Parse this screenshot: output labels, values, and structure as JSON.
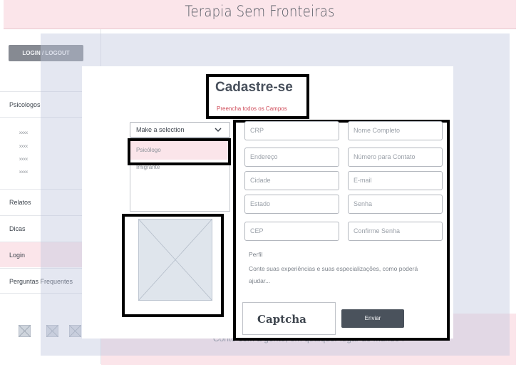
{
  "header": {
    "title": "Terapia Sem Fronteiras"
  },
  "login_button": {
    "label": "LOGIN / LOGOUT"
  },
  "sidebar": {
    "items": [
      {
        "label": "Psicologos"
      },
      {
        "label": "Relatos"
      },
      {
        "label": "Dicas"
      },
      {
        "label": "Login"
      },
      {
        "label": "Perguntas Frequentes"
      }
    ],
    "subitems": [
      "xxxx",
      "xxxx",
      "xxxx",
      "xxxx"
    ]
  },
  "footer": {
    "text": "Conte com a gente, em qualquer lugar do mundo !"
  },
  "social_icons": [
    "image-placeholder-icon",
    "image-placeholder-icon",
    "image-placeholder-icon"
  ],
  "modal": {
    "title": "Cadastre-se",
    "subtitle": "Preencha todos os Campos",
    "select": {
      "value": "Make a selection",
      "options": [
        "Psicólogo",
        "Imigrante"
      ]
    },
    "fields": {
      "crp": "CRP",
      "nome": "Nome Completo",
      "endereco": "Endereço",
      "telefone": "Número para Contato",
      "cidade": "Cidade",
      "email": "E-mail",
      "estado": "Estado",
      "senha": "Senha",
      "cep": "CEP",
      "confirme": "Confirme Senha"
    },
    "perfil": {
      "label": "Perfil",
      "placeholder": "Conte suas experiências e suas especializações, como poderá ajudar..."
    },
    "captcha": "Captcha",
    "submit": "Enviar"
  },
  "colors": {
    "header_bg": "#fbe5ea",
    "overlay": "#bec6de",
    "accent_red": "#cf4a58",
    "button_dark": "#4a525c"
  }
}
